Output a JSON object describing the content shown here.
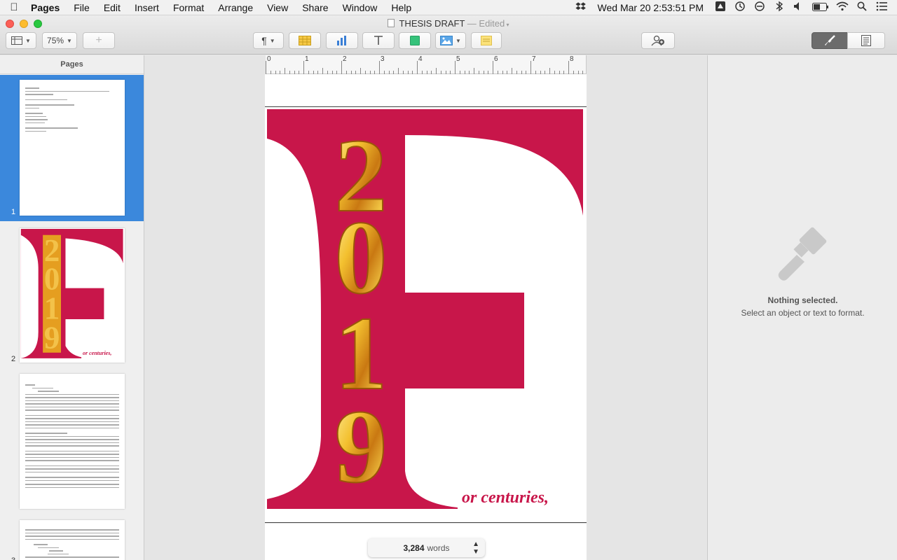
{
  "menubar": {
    "app_name": "Pages",
    "items": [
      "File",
      "Edit",
      "Insert",
      "Format",
      "Arrange",
      "View",
      "Share",
      "Window",
      "Help"
    ],
    "clock": "Wed Mar 20  2:53:51 PM"
  },
  "window": {
    "title": "THESIS DRAFT",
    "edited_suffix": "— Edited"
  },
  "toolbar": {
    "zoom_value": "75%",
    "add_page_symbol": "+"
  },
  "sidebar": {
    "header": "Pages",
    "pages": [
      {
        "number": "1",
        "selected": true
      },
      {
        "number": "2",
        "selected": false,
        "cover_caption": "or centuries,"
      },
      {
        "number": "3",
        "selected": false
      }
    ]
  },
  "ruler": {
    "labels": [
      "0",
      "1",
      "2",
      "3",
      "4",
      "5",
      "6",
      "7",
      "8"
    ]
  },
  "page2": {
    "year_digits": [
      "2",
      "0",
      "1",
      "9"
    ],
    "big_letter": "F",
    "caption": "or centuries,",
    "accent_color": "#c8164a",
    "gold_color": "#e7a51e"
  },
  "word_count": {
    "count": "3,284",
    "unit": "words"
  },
  "inspector": {
    "nothing_selected": "Nothing selected.",
    "hint": "Select an object or text to format."
  }
}
